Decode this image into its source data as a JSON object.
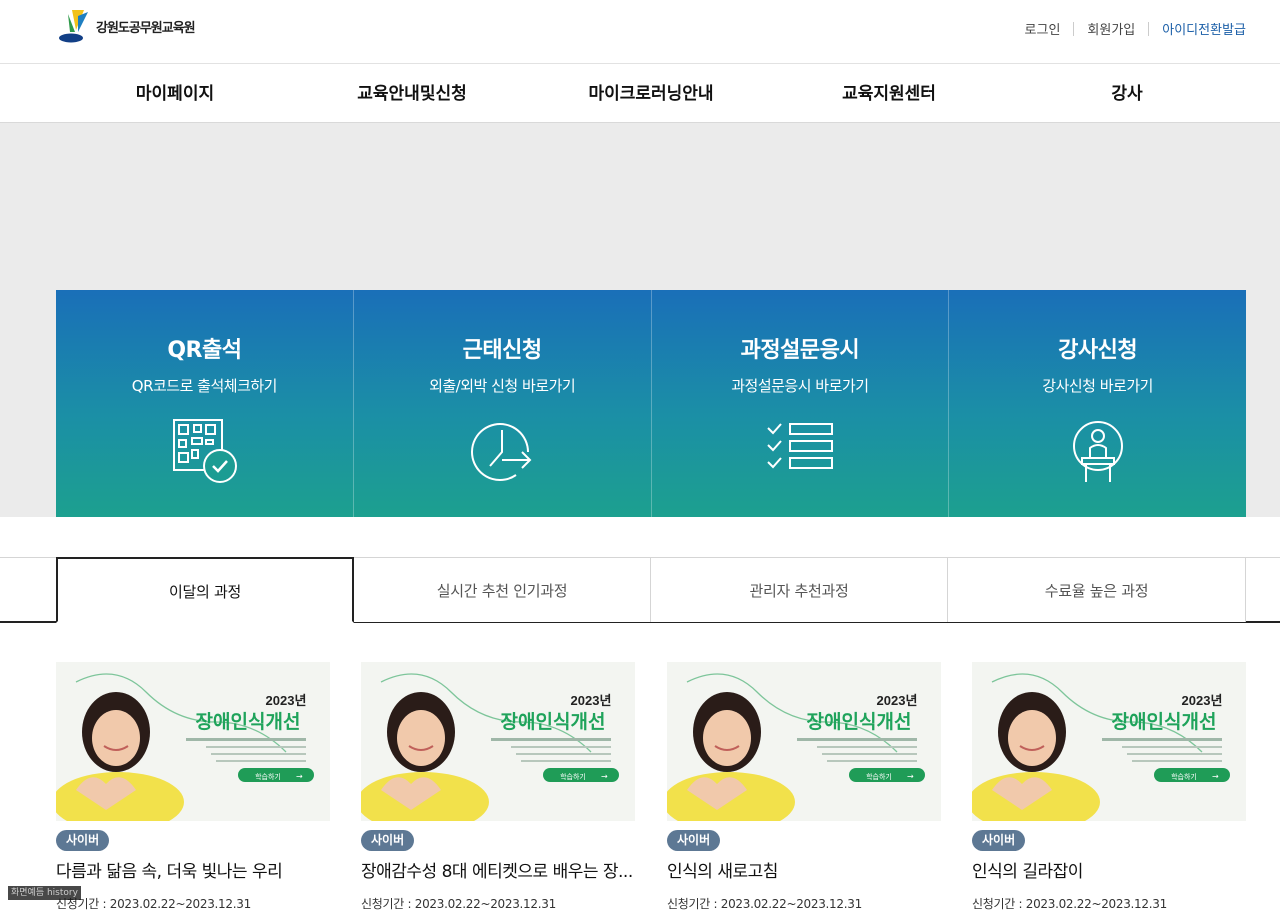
{
  "header": {
    "logo_text": "강원도공무원교육원",
    "util_links": [
      "로그인",
      "회원가입",
      "아이디전환발급"
    ]
  },
  "gnb": [
    "마이페이지",
    "교육안내및신청",
    "마이크로러닝안내",
    "교육지원센터",
    "강사"
  ],
  "quick_menu": [
    {
      "title": "QR출석",
      "subtitle": "QR코드로 출석체크하기",
      "icon": "qr-check-icon"
    },
    {
      "title": "근태신청",
      "subtitle": "외출/외박 신청 바로가기",
      "icon": "clock-arrow-icon"
    },
    {
      "title": "과정설문응시",
      "subtitle": "과정설문응시 바로가기",
      "icon": "checklist-icon"
    },
    {
      "title": "강사신청",
      "subtitle": "강사신청 바로가기",
      "icon": "lecturer-podium-icon"
    }
  ],
  "tabs": [
    {
      "label": "이달의 과정",
      "active": true
    },
    {
      "label": "실시간 추천 인기과정",
      "active": false
    },
    {
      "label": "관리자 추천과정",
      "active": false
    },
    {
      "label": "수료율 높은 과정",
      "active": false
    }
  ],
  "thumbnail": {
    "year": "2023년",
    "headline": "장애인식개선",
    "cta": "학습하기"
  },
  "courses": [
    {
      "badge": "사이버",
      "title": "다름과 닮음 속, 더욱 빛나는 우리",
      "period": "신청기간 : 2023.02.22~2023.12.31"
    },
    {
      "badge": "사이버",
      "title": "장애감수성 8대 에티켓으로 배우는 장...",
      "period": "신청기간 : 2023.02.22~2023.12.31"
    },
    {
      "badge": "사이버",
      "title": "인식의 새로고침",
      "period": "신청기간 : 2023.02.22~2023.12.31"
    },
    {
      "badge": "사이버",
      "title": "인식의 길라잡이",
      "period": "신청기간 : 2023.02.22~2023.12.31"
    }
  ],
  "overlay_text": "화면예듬 history",
  "colors": {
    "accent_link": "#1b5fa8",
    "quick_gradient_top": "#1a6fb8",
    "quick_gradient_bottom": "#1ca08f",
    "badge": "#5d7894",
    "headline_green": "#1fa35b"
  }
}
